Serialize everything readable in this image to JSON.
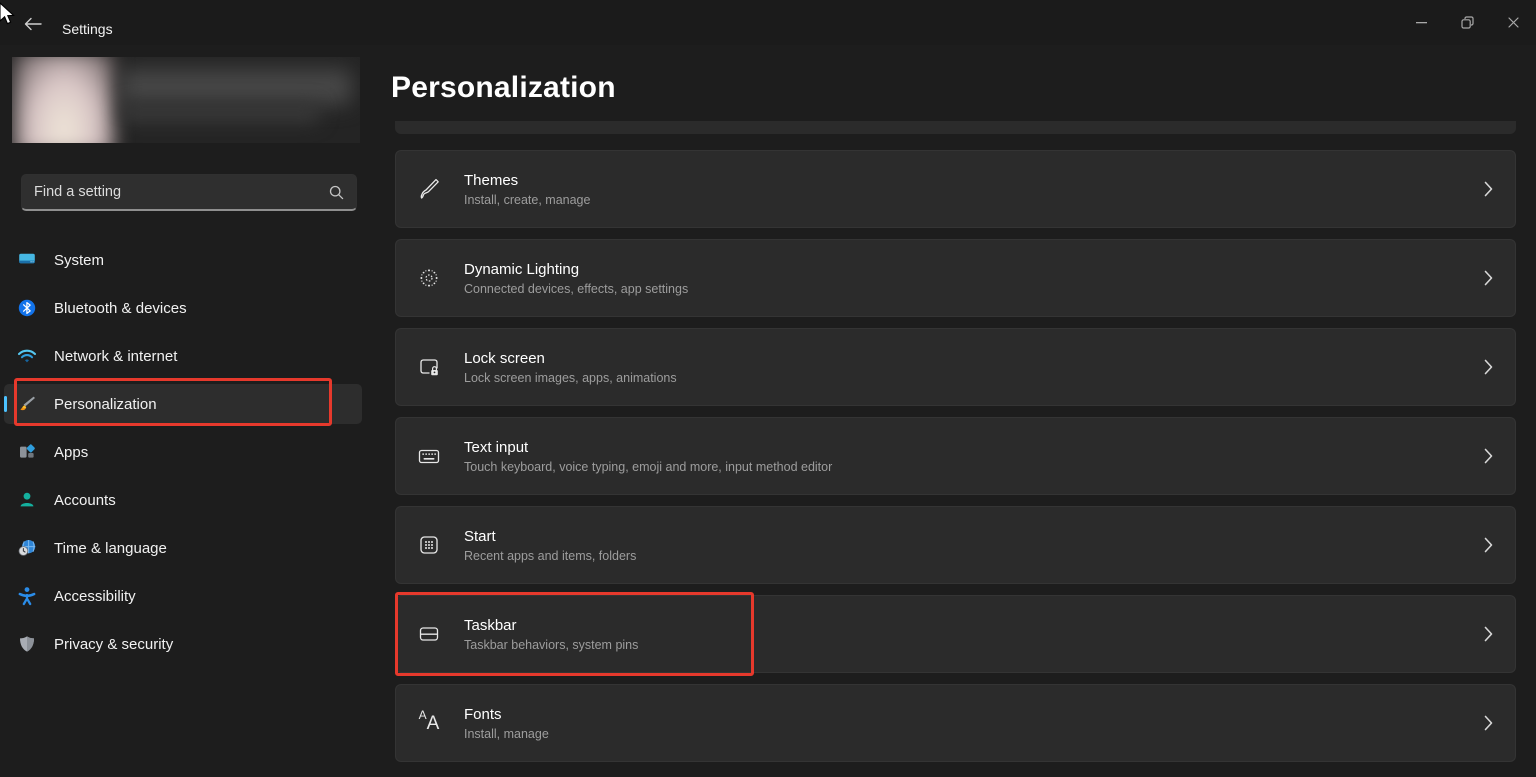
{
  "window": {
    "title": "Settings"
  },
  "sidebar": {
    "search_placeholder": "Find a setting",
    "items": [
      {
        "label": "System"
      },
      {
        "label": "Bluetooth & devices"
      },
      {
        "label": "Network & internet"
      },
      {
        "label": "Personalization",
        "selected": true
      },
      {
        "label": "Apps"
      },
      {
        "label": "Accounts"
      },
      {
        "label": "Time & language"
      },
      {
        "label": "Accessibility"
      },
      {
        "label": "Privacy & security"
      }
    ]
  },
  "main": {
    "title": "Personalization",
    "items": [
      {
        "title": "Themes",
        "subtitle": "Install, create, manage"
      },
      {
        "title": "Dynamic Lighting",
        "subtitle": "Connected devices, effects, app settings"
      },
      {
        "title": "Lock screen",
        "subtitle": "Lock screen images, apps, animations"
      },
      {
        "title": "Text input",
        "subtitle": "Touch keyboard, voice typing, emoji and more, input method editor"
      },
      {
        "title": "Start",
        "subtitle": "Recent apps and items, folders"
      },
      {
        "title": "Taskbar",
        "subtitle": "Taskbar behaviors, system pins",
        "annotated": true
      },
      {
        "title": "Fonts",
        "subtitle": "Install, manage"
      }
    ]
  },
  "fonts_icon": {
    "small_a": "A",
    "large_a": "A"
  },
  "colors": {
    "background": "#1d1d1d",
    "card": "#2b2b2b",
    "accent_pill": "#4cc2ff",
    "annotation_red": "#e6392c",
    "subtitle_gray": "#9d9d9d"
  }
}
